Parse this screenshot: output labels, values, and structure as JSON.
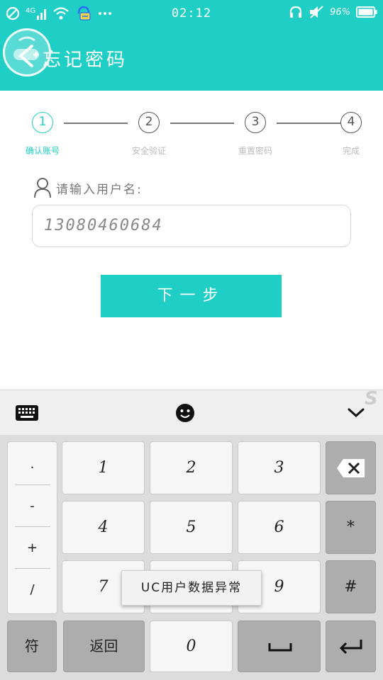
{
  "status_bar": {
    "network": "4G",
    "time": "02:12",
    "battery": "96%"
  },
  "header": {
    "title": "忘记密码"
  },
  "stepper": {
    "steps": [
      {
        "number": "1",
        "label": "确认账号",
        "active": true
      },
      {
        "number": "2",
        "label": "安全验证",
        "active": false
      },
      {
        "number": "3",
        "label": "重置密码",
        "active": false
      },
      {
        "number": "4",
        "label": "完成",
        "active": false
      }
    ]
  },
  "form": {
    "username_label": "请输入用户名:",
    "username_value": "13080460684",
    "next_button": "下一步"
  },
  "keyboard": {
    "symbols": [
      ".",
      "-",
      "+",
      "/"
    ],
    "keys": {
      "k1": "1",
      "k2": "2",
      "k3": "3",
      "k4": "4",
      "k5": "5",
      "k6": "6",
      "k7": "7",
      "k9": "9",
      "k0": "0",
      "star": "*",
      "hash": "#",
      "symbol_key": "符",
      "return_key": "返回"
    },
    "popup": "UC用户数据异常"
  },
  "colors": {
    "accent": "#1fcfc6",
    "key_dark": "#adadad",
    "key_light": "#f6f6f6"
  }
}
